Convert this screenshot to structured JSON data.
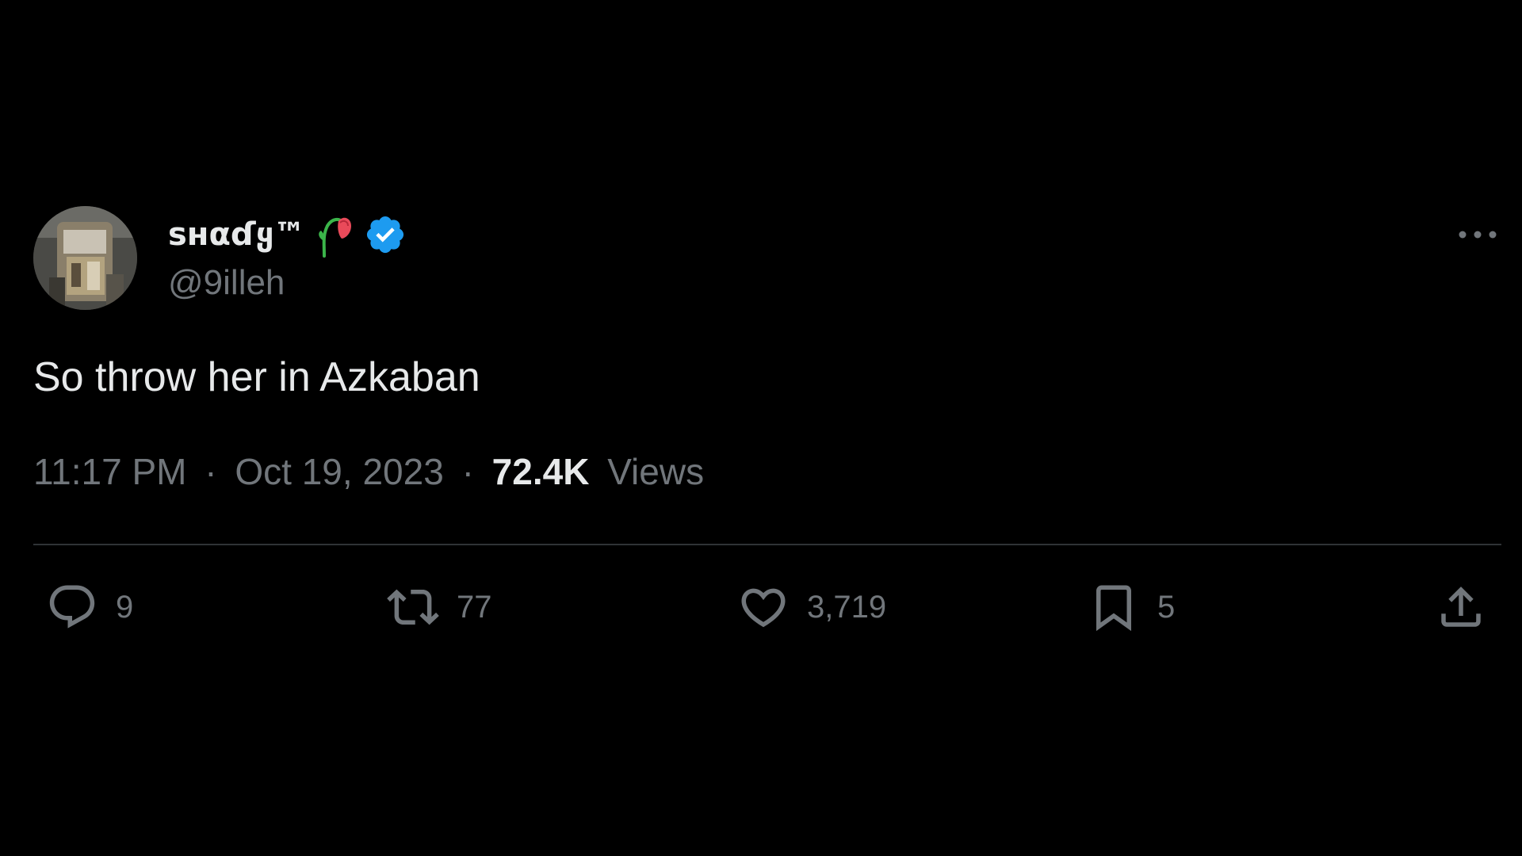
{
  "author": {
    "display_name": "sʜαɗყ™",
    "handle": "@9illeh",
    "verified": true,
    "name_emoji": "wilted-rose-icon"
  },
  "tweet": {
    "text": "So throw her in Azkaban"
  },
  "meta": {
    "time": "11:17 PM",
    "separator": "·",
    "date": "Oct 19, 2023",
    "views_count": "72.4K",
    "views_label": "Views"
  },
  "actions": {
    "replies": "9",
    "reposts": "77",
    "likes": "3,719",
    "bookmarks": "5"
  },
  "icons": {
    "more": "more-horizontal-icon",
    "reply": "reply-icon",
    "repost": "repost-icon",
    "like": "heart-icon",
    "bookmark": "bookmark-icon",
    "share": "share-icon"
  },
  "colors": {
    "background": "#000000",
    "primary_text": "#e7e9ea",
    "secondary_text": "#71767b",
    "divider": "#2f3336",
    "verified_blue": "#1d9bf0"
  }
}
